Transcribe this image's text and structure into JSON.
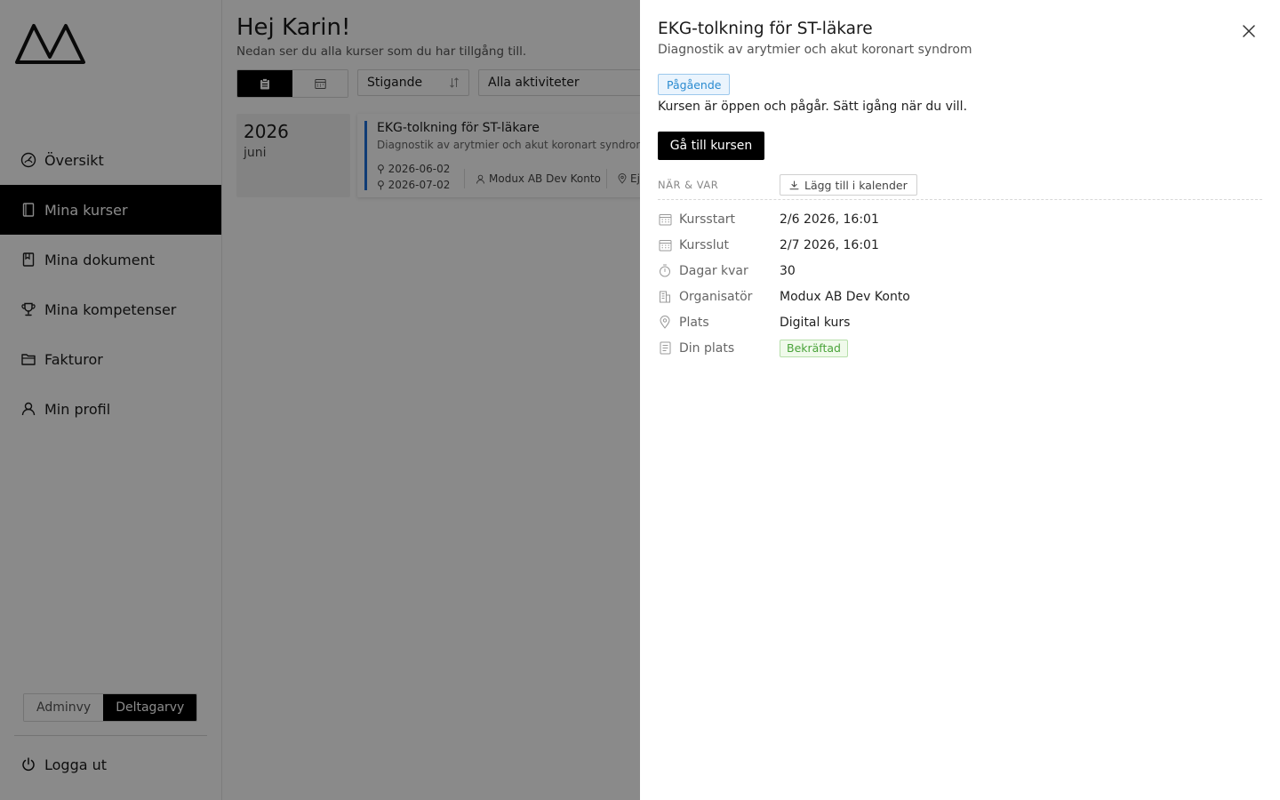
{
  "sidebar": {
    "nav": [
      {
        "label": "Översikt",
        "icon": "gauge-icon"
      },
      {
        "label": "Mina kurser",
        "icon": "notebook-icon",
        "active": true
      },
      {
        "label": "Mina dokument",
        "icon": "book-icon"
      },
      {
        "label": "Mina kompetenser",
        "icon": "trophy-icon"
      },
      {
        "label": "Fakturor",
        "icon": "folder-icon"
      },
      {
        "label": "Min profil",
        "icon": "user-icon"
      }
    ],
    "view_toggle": {
      "admin": "Adminvy",
      "participant": "Deltagarvy",
      "active": "participant"
    },
    "logout": "Logga ut"
  },
  "main": {
    "greeting": "Hej Karin!",
    "subtitle": "Nedan ser du alla kurser som du har tillgång till.",
    "sort_label": "Stigande",
    "filter_label": "Alla aktiviteter",
    "year": "2026",
    "month": "juni",
    "card": {
      "title": "EKG-tolkning för ST-läkare",
      "subtitle": "Diagnostik av arytmier och akut koronart syndrom",
      "start_date": "2026-06-02",
      "end_date": "2026-07-02",
      "organizer": "Modux AB Dev Konto",
      "location_partial": "Ej"
    }
  },
  "drawer": {
    "title": "EKG-tolkning för ST-läkare",
    "subtitle": "Diagnostik av arytmier och akut koronart syndrom",
    "status": "Pågående",
    "description": "Kursen är öppen och pågår. Sätt igång när du vill.",
    "goto_button": "Gå till kursen",
    "section_label": "NÄR & VAR",
    "add_calendar": "Lägg till i kalender",
    "details": [
      {
        "label": "Kursstart",
        "value": "2/6 2026, 16:01",
        "icon": "calendar-icon"
      },
      {
        "label": "Kursslut",
        "value": "2/7 2026, 16:01",
        "icon": "calendar-icon"
      },
      {
        "label": "Dagar kvar",
        "value": "30",
        "icon": "stopwatch-icon"
      },
      {
        "label": "Organisatör",
        "value": "Modux AB Dev Konto",
        "icon": "building-icon"
      },
      {
        "label": "Plats",
        "value": "Digital kurs",
        "icon": "map-pin-icon"
      },
      {
        "label": "Din plats",
        "value": "Bekräftad",
        "icon": "document-icon",
        "badge": true
      }
    ]
  },
  "colors": {
    "accent": "#000000",
    "card_accent": "#1e6fd9",
    "status_blue": "#2a8bd0",
    "confirmed_green": "#4aa33a"
  }
}
